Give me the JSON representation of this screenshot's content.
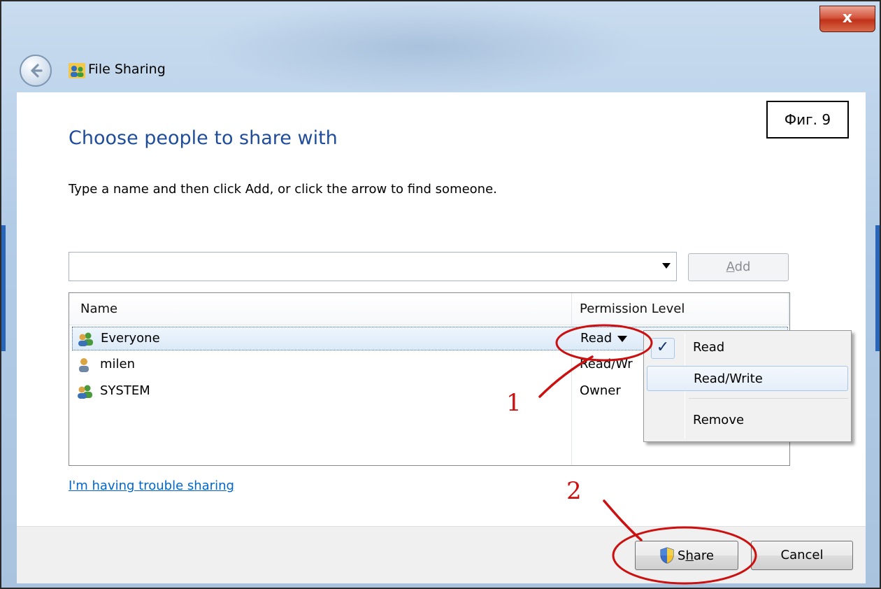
{
  "window": {
    "title": "File Sharing",
    "close_label": "x",
    "back_icon": "back-arrow-icon",
    "title_icon": "users-icon"
  },
  "figure_label": "Фиг. 9",
  "main": {
    "heading": "Choose people to share with",
    "instruction": "Type a name and then click Add, or click the arrow to find someone.",
    "name_input": {
      "value": "",
      "placeholder": ""
    },
    "add_button": {
      "accel": "A",
      "rest": "dd"
    }
  },
  "table": {
    "columns": [
      "Name",
      "Permission Level"
    ],
    "rows": [
      {
        "name": "Everyone",
        "permission": "Read",
        "icon": "group-icon",
        "selected": true
      },
      {
        "name": "milen",
        "permission": "Read/Wr",
        "icon": "user-icon",
        "selected": false
      },
      {
        "name": "SYSTEM",
        "permission": "Owner",
        "icon": "group-icon",
        "selected": false
      }
    ]
  },
  "permission_menu": {
    "items": [
      {
        "label": "Read",
        "checked": true
      },
      {
        "label": "Read/Write",
        "checked": false,
        "hover": true
      },
      {
        "label": "Remove",
        "checked": false
      }
    ],
    "check_glyph": "✓"
  },
  "help_link": "I'm having trouble sharing",
  "buttons": {
    "share": {
      "before": "S",
      "accel": "h",
      "after": "are"
    },
    "cancel": "Cancel"
  },
  "annotations": {
    "step1": "1",
    "step2": "2",
    "color": "#cc1010"
  },
  "colors": {
    "heading": "#1f4d9b",
    "link": "#0066cc",
    "frame": "#b2cbe6"
  }
}
